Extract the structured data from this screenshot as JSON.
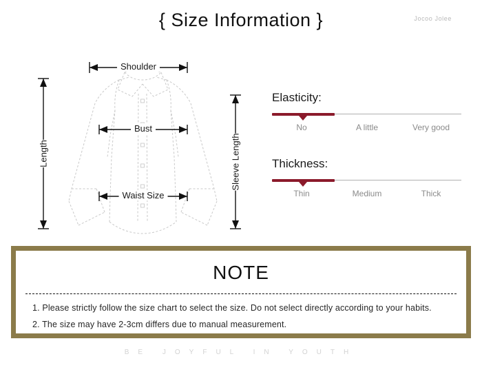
{
  "header": {
    "title": "{ Size Information }",
    "brand": "Jocoo Jolee"
  },
  "diagram": {
    "name": "shirt-measurement-diagram",
    "measurements": [
      {
        "key": "shoulder",
        "label": "Shoulder",
        "orientation": "horizontal"
      },
      {
        "key": "bust",
        "label": "Bust",
        "orientation": "horizontal"
      },
      {
        "key": "waist_size",
        "label": "Waist Size",
        "orientation": "horizontal"
      },
      {
        "key": "length",
        "label": "Length",
        "orientation": "vertical"
      },
      {
        "key": "sleeve_length",
        "label": "Sleeve Length",
        "orientation": "vertical"
      }
    ]
  },
  "scales": [
    {
      "key": "elasticity",
      "title": "Elasticity:",
      "options": [
        "No",
        "A little",
        "Very good"
      ],
      "selected": "No",
      "selected_index": 0
    },
    {
      "key": "thickness",
      "title": "Thickness:",
      "options": [
        "Thin",
        "Medium",
        "Thick"
      ],
      "selected": "Thin",
      "selected_index": 0
    }
  ],
  "note": {
    "heading": "NOTE",
    "lines": [
      "1. Please strictly follow the size chart to select the size. Do not select directly according to your habits.",
      "2. The size may have 2-3cm differs due to manual measurement."
    ]
  },
  "footer": {
    "text": "BE JOYFUL IN YOUTH"
  },
  "colors": {
    "accent_red": "#8B1A2B",
    "note_border": "#8B7B4A",
    "diagram_line": "#c9c9c9",
    "text_dark": "#1a1a1a",
    "text_muted": "#8a8a8a",
    "footer_text": "#d2d2d2",
    "background": "#ffffff"
  }
}
